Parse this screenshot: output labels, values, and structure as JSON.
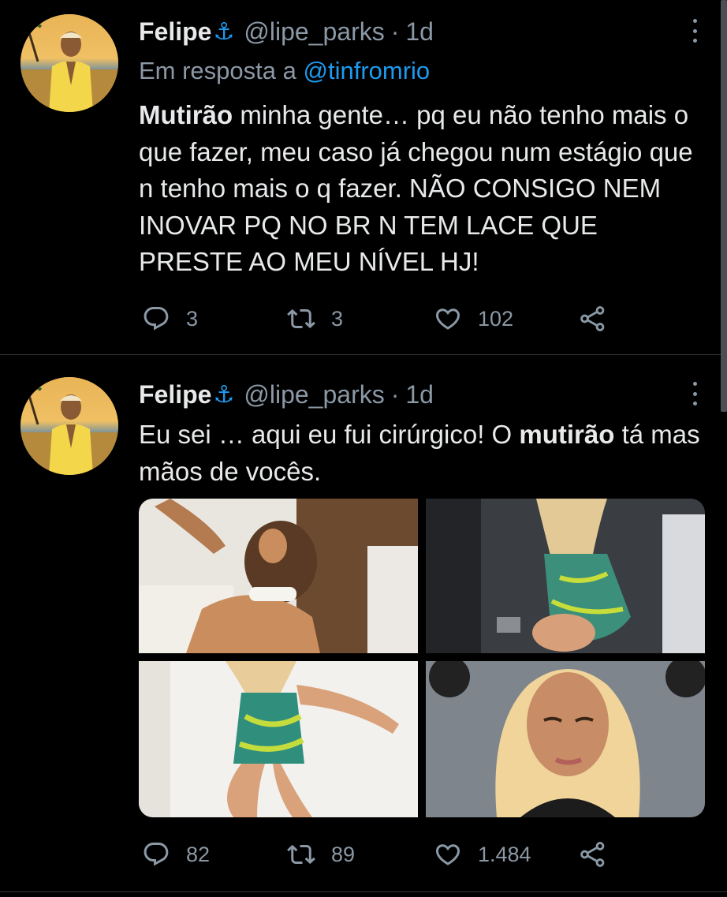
{
  "tweets": [
    {
      "display_name": "Felipe",
      "handle": "@lipe_parks",
      "time": "1d",
      "reply_prefix": "Em resposta a",
      "reply_to": "@tinfromrio",
      "text_bold": "Mutirão",
      "text_rest": " minha gente… pq eu não tenho mais o que fazer, meu caso já chegou num estágio que n tenho mais o q fazer. NÃO CONSIGO NEM INOVAR PQ NO BR N TEM LACE QUE PRESTE AO MEU NÍVEL HJ!",
      "replies": "3",
      "retweets": "3",
      "likes": "102"
    },
    {
      "display_name": "Felipe",
      "handle": "@lipe_parks",
      "time": "1d",
      "text_pre": "Eu sei … aqui eu fui cirúrgico! O ",
      "text_bold": "mutirão",
      "text_post": " tá mas mãos de vocês.",
      "replies": "82",
      "retweets": "89",
      "likes": "1.484"
    }
  ],
  "separator": "·",
  "anchor_glyph": "⚓",
  "icons": {
    "reply": "reply-icon",
    "retweet": "retweet-icon",
    "like": "heart-icon",
    "share": "share-icon",
    "more": "more-icon",
    "verified_emoji": "anchor-icon"
  },
  "colors": {
    "background": "#000000",
    "text": "#e7e9ea",
    "secondary": "#8b98a5",
    "accent": "#1d9bf0"
  }
}
